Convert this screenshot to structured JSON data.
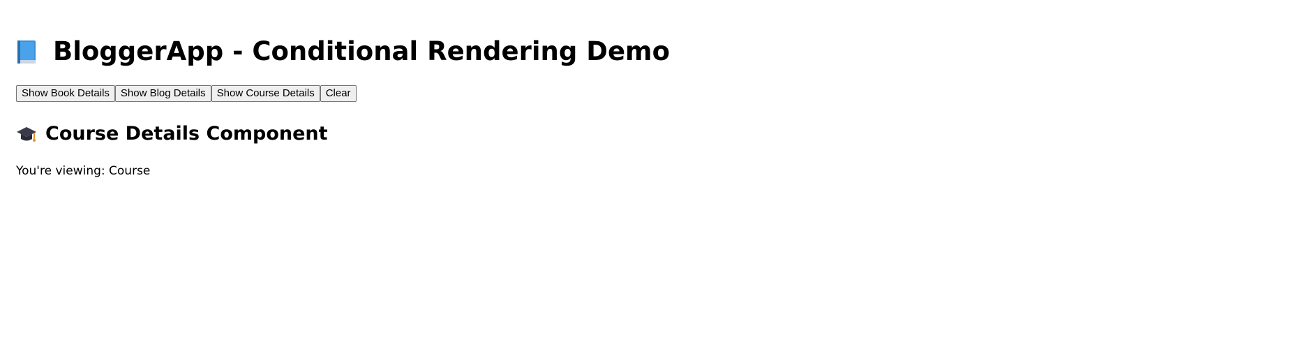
{
  "header": {
    "title": "BloggerApp - Conditional Rendering Demo",
    "icon": "blue-book-icon"
  },
  "toolbar": {
    "buttons": [
      {
        "label": "Show Book Details"
      },
      {
        "label": "Show Blog Details"
      },
      {
        "label": "Show Course Details"
      },
      {
        "label": "Clear"
      }
    ]
  },
  "content": {
    "section_title": "Course Details Component",
    "section_icon": "graduation-cap-icon",
    "viewing_label": "You're viewing:",
    "viewing_value": "Course"
  },
  "colors": {
    "book_blue": "#3b8fd9",
    "cap_dark": "#3a3a4a",
    "tassel": "#e8912a"
  }
}
